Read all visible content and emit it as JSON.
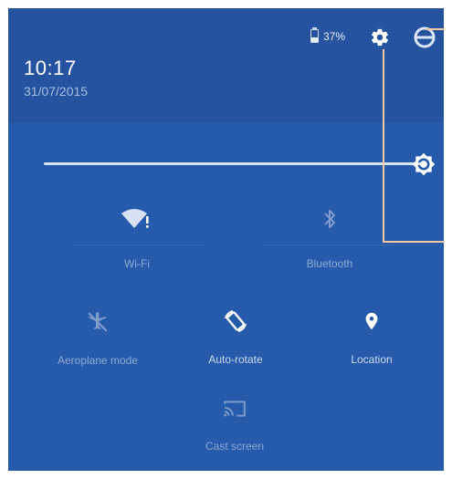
{
  "status": {
    "time": "10:17",
    "date": "31/07/2015",
    "battery_percent": "37%"
  },
  "icons": {
    "settings": "gear-icon",
    "account": "account-icon",
    "brightness": "brightness-icon"
  },
  "brightness": {
    "level": 1.0
  },
  "tiles": {
    "wifi": {
      "label": "Wi-Fi",
      "icon": "wifi-icon",
      "badge": "!"
    },
    "bluetooth": {
      "label": "Bluetooth",
      "icon": "bluetooth-icon"
    },
    "airplane": {
      "label": "Aeroplane mode",
      "icon": "airplane-icon"
    },
    "rotate": {
      "label": "Auto-rotate",
      "icon": "auto-rotate-icon"
    },
    "location": {
      "label": "Location",
      "icon": "location-icon"
    },
    "cast": {
      "label": "Cast screen",
      "icon": "cast-icon"
    }
  },
  "colors": {
    "panel": "#265bab",
    "header": "#2553a0",
    "active": "#ffffff",
    "inactive": "#8fa8d2",
    "callout": "#f3c9a3"
  }
}
